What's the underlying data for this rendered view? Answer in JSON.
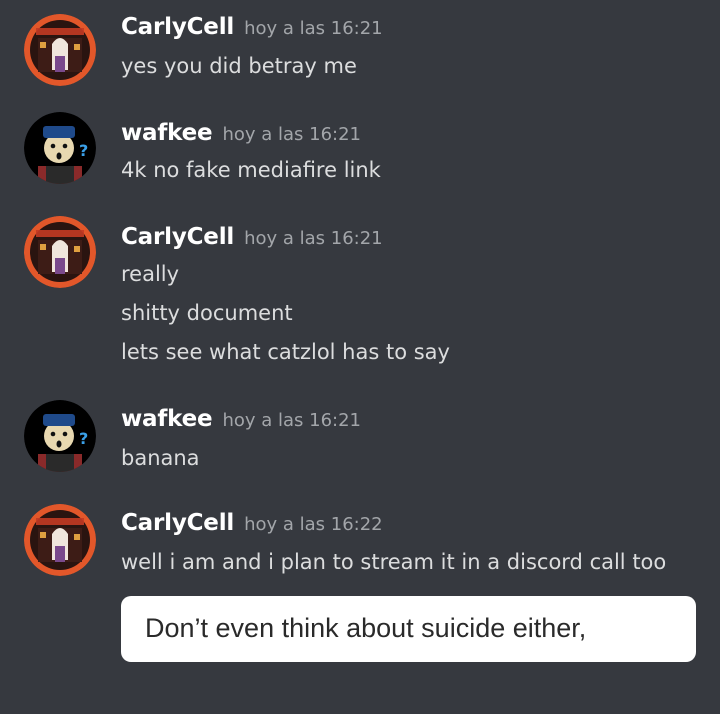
{
  "messages": [
    {
      "user": "CarlyCell",
      "time": "hoy a las 16:21",
      "lines": [
        "yes you did betray me"
      ]
    },
    {
      "user": "wafkee",
      "time": "hoy a las 16:21",
      "lines": [
        "4k no fake mediafire link"
      ]
    },
    {
      "user": "CarlyCell",
      "time": "hoy a las 16:21",
      "lines": [
        "really",
        "shitty document",
        "lets see what catzlol has to say"
      ]
    },
    {
      "user": "wafkee",
      "time": "hoy a las 16:21",
      "lines": [
        "banana"
      ]
    },
    {
      "user": "CarlyCell",
      "time": "hoy a las 16:22",
      "lines": [
        "well i am and i plan to stream it in a discord call too"
      ]
    }
  ],
  "attachment": {
    "text": "Don’t even think about suicide either,"
  },
  "colors": {
    "background": "#36393f",
    "username": "#ffffff",
    "timestamp": "#a3a6aa",
    "text": "#dcddde"
  }
}
